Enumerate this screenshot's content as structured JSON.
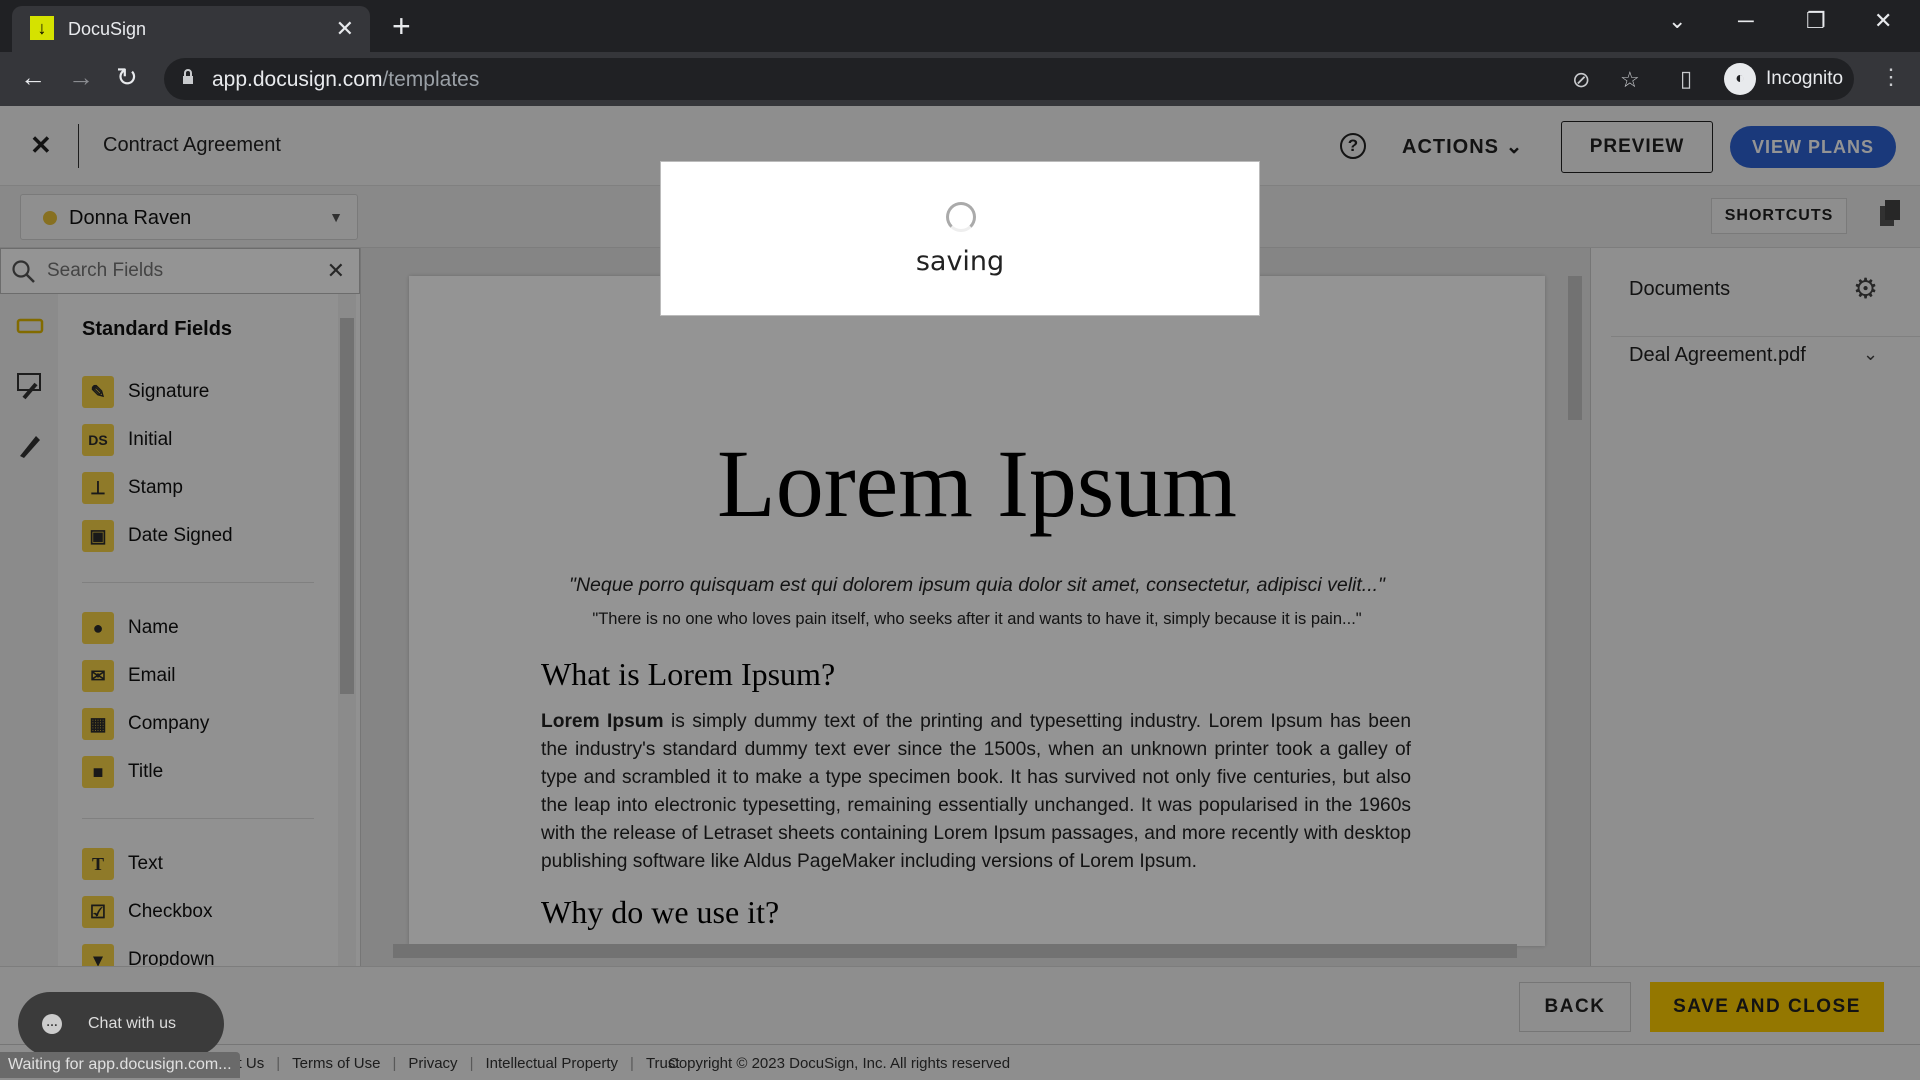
{
  "browser": {
    "tab_title": "DocuSign",
    "favicon": "download-arrow-icon",
    "url_host": "app.docusign.com",
    "url_path": "/templates",
    "profile_label": "Incognito",
    "status_text": "Waiting for app.docusign.com..."
  },
  "header": {
    "close_icon": "x",
    "title": "Contract Agreement",
    "help_icon": "?",
    "actions_label": "ACTIONS",
    "preview_label": "PREVIEW",
    "view_plans_label": "VIEW PLANS",
    "accent_color": "#2d63d5"
  },
  "toolbar": {
    "recipient_name": "Donna Raven",
    "recipient_color": "#e8c13a",
    "shortcuts_label": "SHORTCUTS"
  },
  "search": {
    "placeholder": "Search Fields",
    "value": ""
  },
  "fields_panel": {
    "section_title": "Standard Fields",
    "groups": [
      [
        {
          "label": "Signature",
          "icon": "signature-pen-icon",
          "glyph": "✎"
        },
        {
          "label": "Initial",
          "icon": "initial-ds-icon",
          "glyph": "DS"
        },
        {
          "label": "Stamp",
          "icon": "stamp-icon",
          "glyph": "⊥"
        },
        {
          "label": "Date Signed",
          "icon": "calendar-icon",
          "glyph": "▣"
        }
      ],
      [
        {
          "label": "Name",
          "icon": "person-icon",
          "glyph": "●"
        },
        {
          "label": "Email",
          "icon": "envelope-icon",
          "glyph": "✉"
        },
        {
          "label": "Company",
          "icon": "building-icon",
          "glyph": "▦"
        },
        {
          "label": "Title",
          "icon": "briefcase-icon",
          "glyph": "■"
        }
      ],
      [
        {
          "label": "Text",
          "icon": "text-t-icon",
          "glyph": "T"
        },
        {
          "label": "Checkbox",
          "icon": "checkbox-icon",
          "glyph": "☑"
        },
        {
          "label": "Dropdown",
          "icon": "dropdown-icon",
          "glyph": "▾"
        }
      ]
    ],
    "field_accent_color": "#f6d248"
  },
  "document": {
    "title": "Lorem Ipsum",
    "quote_1": "\"Neque porro quisquam est qui dolorem ipsum quia dolor sit amet, consectetur, adipisci velit...\"",
    "quote_2": "\"There is no one who loves pain itself, who seeks after it and wants to have it, simply because it is pain...\"",
    "heading_1": "What is Lorem Ipsum?",
    "para_bold": "Lorem Ipsum",
    "para_rest": " is simply dummy text of the printing and typesetting industry. Lorem Ipsum has been the industry's standard dummy text ever since the 1500s, when an unknown printer took a galley of type and scrambled it to make a type specimen book. It has survived not only five centuries, but also the leap into electronic typesetting, remaining essentially unchanged. It was popularised in the 1960s with the release of Letraset sheets containing Lorem Ipsum passages, and more recently with desktop publishing software like Aldus PageMaker including versions of Lorem Ipsum.",
    "heading_2": "Why do we use it?"
  },
  "documents_panel": {
    "title": "Documents",
    "items": [
      "Deal Agreement.pdf"
    ]
  },
  "footer": {
    "back_label": "BACK",
    "save_close_label": "SAVE AND CLOSE",
    "save_color": "#ffce00",
    "links": [
      "Contact Us",
      "Terms of Use",
      "Privacy",
      "Intellectual Property",
      "Trust"
    ],
    "copyright": "Copyright © 2023 DocuSign, Inc. All rights reserved"
  },
  "chat": {
    "label": "Chat with us"
  },
  "modal": {
    "message": "saving"
  }
}
